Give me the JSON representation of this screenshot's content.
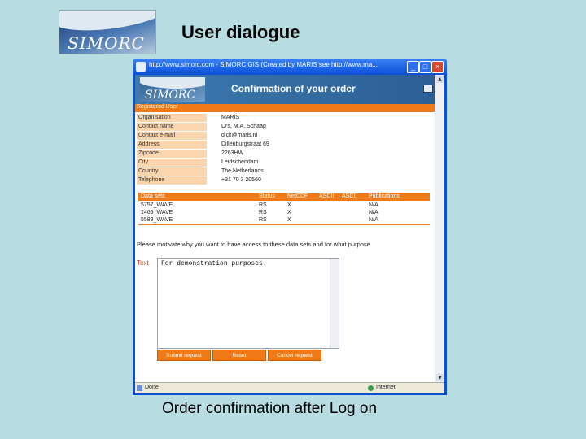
{
  "slide": {
    "title": "User dialogue",
    "caption": "Order confirmation after Log on",
    "logo_text": "SIMORC"
  },
  "window": {
    "title": "http://www.simorc.com - SIMORC GIS (Created by MARIS see http://www.ma...",
    "buttons": [
      "_",
      "□",
      "×"
    ]
  },
  "page": {
    "logo_text": "SIMORC",
    "header_title": "Confirmation of your order",
    "registered_label": "Registered User",
    "user_fields": [
      {
        "label": "Organisation",
        "value": "MARIS"
      },
      {
        "label": "Contact name",
        "value": "Drs. M.A. Schaap"
      },
      {
        "label": "Contact e-mail",
        "value": "dick@maris.nl"
      },
      {
        "label": "Address",
        "value": "Dillenburgstraat 69"
      },
      {
        "label": "Zipcode",
        "value": "2263HW"
      },
      {
        "label": "City",
        "value": "Leidschendam"
      },
      {
        "label": "Country",
        "value": "The Netherlands"
      },
      {
        "label": "Telephone",
        "value": "+31 70 3 20560"
      }
    ],
    "datasets": {
      "headers": [
        "Data sets",
        "Status",
        "NetCDF",
        "ASCII",
        "ASCII",
        "Publications"
      ],
      "rows": [
        [
          "5757_WAVE",
          "RS",
          "X",
          "N/A"
        ],
        [
          "1465_WAVE",
          "RS",
          "X",
          "N/A"
        ],
        [
          "5583_WAVE",
          "RS",
          "X",
          "N/A"
        ]
      ]
    },
    "motivate_text": "Please motivate why you want to have access to these data sets and for what purpose",
    "text_label": "Text",
    "textarea_value": "For demonstration purposes.",
    "buttons": [
      "Submit request",
      "Reset",
      "Cancel request"
    ]
  },
  "statusbar": {
    "left": "Done",
    "right": "Internet"
  },
  "colors": {
    "background": "#b7dde2",
    "accent_orange": "#f07b16",
    "window_blue": "#0a4fd8"
  }
}
